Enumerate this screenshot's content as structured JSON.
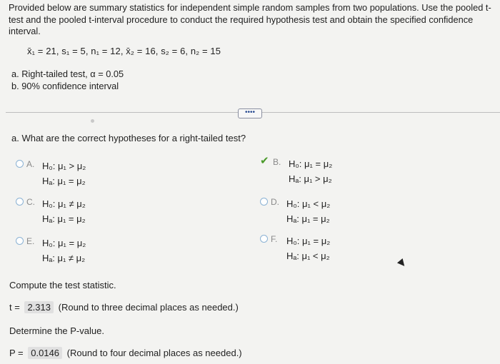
{
  "intro": "Provided below are summary statistics for independent simple random samples from two populations. Use the pooled t-test and the pooled t-interval procedure to conduct the required hypothesis test and obtain the specified confidence interval.",
  "stats": "x̄₁ = 21, s₁ = 5, n₁ = 12, x̄₂ = 16, s₂ = 6, n₂ = 15",
  "parts": {
    "a": "a. Right-tailed test, α = 0.05",
    "b": "b. 90% confidence interval"
  },
  "more_button": "••••",
  "question": "a. What are the correct hypotheses for a right-tailed test?",
  "options": [
    {
      "letter": "A.",
      "h0": "H₀: μ₁ > μ₂",
      "ha": "Hₐ: μ₁ = μ₂",
      "selected": false
    },
    {
      "letter": "B.",
      "h0": "H₀: μ₁ = μ₂",
      "ha": "Hₐ: μ₁ > μ₂",
      "selected": true
    },
    {
      "letter": "C.",
      "h0": "H₀: μ₁ ≠ μ₂",
      "ha": "Hₐ: μ₁ = μ₂",
      "selected": false
    },
    {
      "letter": "D.",
      "h0": "H₀: μ₁ < μ₂",
      "ha": "Hₐ: μ₁ = μ₂",
      "selected": false
    },
    {
      "letter": "E.",
      "h0": "H₀: μ₁ = μ₂",
      "ha": "Hₐ: μ₁ ≠ μ₂",
      "selected": false
    },
    {
      "letter": "F.",
      "h0": "H₀: μ₁ = μ₂",
      "ha": "Hₐ: μ₁ < μ₂",
      "selected": false
    }
  ],
  "compute_label": "Compute the test statistic.",
  "t_stat": {
    "prefix": "t =",
    "value": "2.313",
    "note": "(Round to three decimal places as needed.)"
  },
  "pvalue_label": "Determine the P-value.",
  "p_value": {
    "prefix": "P =",
    "value": "0.0146",
    "note": "(Round to four decimal places as needed.)"
  },
  "colors": {
    "check": "#4a9a2a",
    "radio_border": "#8bb2d4"
  }
}
